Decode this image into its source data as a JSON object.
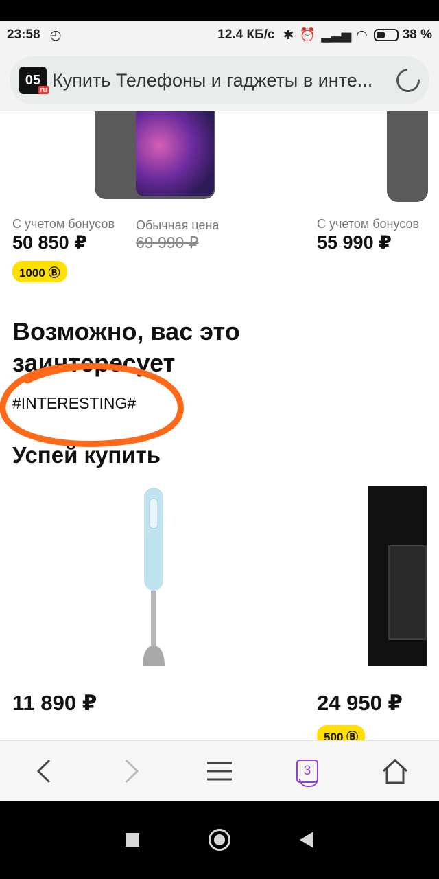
{
  "status_bar": {
    "time": "23:58",
    "network_speed": "12.4 КБ/с",
    "battery": "38 %"
  },
  "browser": {
    "logo_text": "05",
    "logo_sub": "ru",
    "url_title": "Купить Телефоны и гаджеты в инте..."
  },
  "products_top": [
    {
      "label": "С учетом бонусов",
      "price": "50 850 ₽",
      "old_label": "Обычная цена",
      "old_price": "69 990 ₽",
      "bonus": "1000 Ⓑ"
    },
    {
      "label": "С учетом бонусов",
      "price": "55 990 ₽"
    }
  ],
  "section_interest": {
    "title": "Возможно, вас это заинтересует",
    "placeholder": "#INTERESTING#"
  },
  "section_hurry": {
    "title": "Успей купить",
    "items": [
      {
        "price": "11 890 ₽"
      },
      {
        "price": "24 950 ₽",
        "bonus": "500 Ⓑ"
      }
    ]
  },
  "bottom_nav": {
    "tabs_count": "3"
  },
  "colors": {
    "accent_purple": "#8f3fd6",
    "bonus_yellow": "#ffe000",
    "annotation_orange": "#ff6a1a"
  }
}
